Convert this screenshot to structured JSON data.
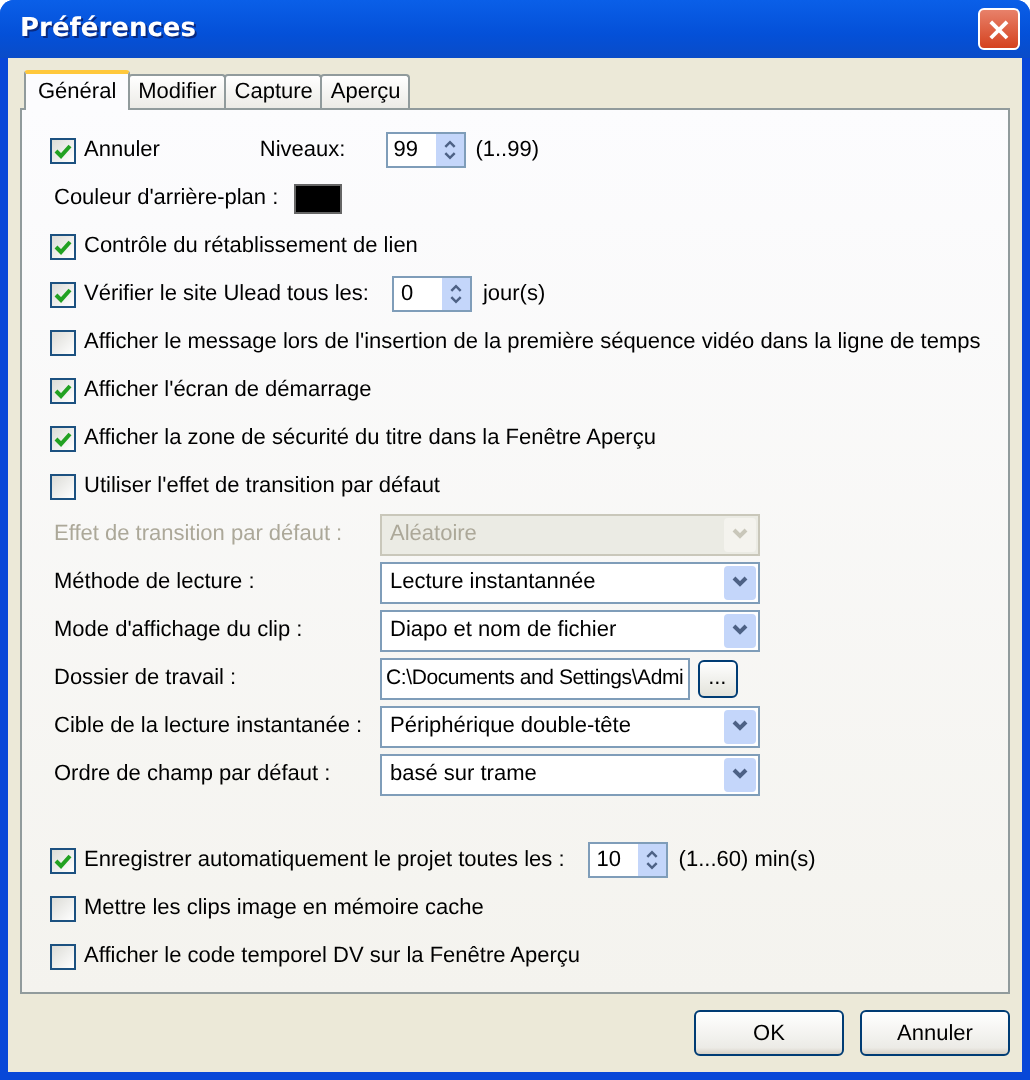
{
  "window": {
    "title": "Préférences",
    "close": "×"
  },
  "tabs": [
    {
      "label": "Général",
      "selected": true
    },
    {
      "label": "Modifier",
      "selected": false
    },
    {
      "label": "Capture",
      "selected": false
    },
    {
      "label": "Aperçu",
      "selected": false
    }
  ],
  "sections": [
    {
      "rows": [
        {
          "kind": "check_spin",
          "label": "Annuler",
          "checked": true,
          "spin_label": "Niveaux:",
          "value": "99",
          "suffix": "(1..99)"
        },
        {
          "kind": "color",
          "label": "Couleur d'arrière-plan :",
          "color": "#000000"
        },
        {
          "kind": "check",
          "label": "Contrôle du rétablissement de lien",
          "checked": true
        },
        {
          "kind": "check_spin",
          "label": "Vérifier le site Ulead tous les:",
          "checked": true,
          "value": "0",
          "suffix": "jour(s)"
        },
        {
          "kind": "check",
          "label": "Afficher le message lors de l'insertion de la première séquence vidéo dans la ligne de temps",
          "checked": false
        },
        {
          "kind": "check",
          "label": "Afficher l'écran de démarrage",
          "checked": true
        },
        {
          "kind": "check",
          "label": "Afficher la zone de sécurité du titre dans la Fenêtre Aperçu",
          "checked": true
        },
        {
          "kind": "check",
          "label": "Utiliser l'effet de transition par défaut",
          "checked": false
        },
        {
          "kind": "select",
          "label": "Effet de transition par défaut :",
          "value": "Aléatoire",
          "disabled": true
        },
        {
          "kind": "select",
          "label": "Méthode de lecture :",
          "value": "Lecture instantannée",
          "disabled": false
        },
        {
          "kind": "select",
          "label": "Mode d'affichage du clip :",
          "value": "Diapo et nom de fichier",
          "disabled": false
        },
        {
          "kind": "path",
          "label": "Dossier de travail :",
          "value": "C:\\Documents and Settings\\Admi",
          "button": "..."
        },
        {
          "kind": "select",
          "label": "Cible de la lecture instantanée :",
          "value": "Périphérique double-tête",
          "disabled": false
        },
        {
          "kind": "select",
          "label": "Ordre de champ par défaut :",
          "value": "basé sur trame",
          "disabled": false
        }
      ]
    },
    {
      "rows": [
        {
          "kind": "check_spin",
          "label": "Enregistrer automatiquement le projet toutes les :",
          "checked": true,
          "value": "10",
          "suffix": "(1...60) min(s)"
        },
        {
          "kind": "check",
          "label": "Mettre les clips image en mémoire cache",
          "checked": false
        },
        {
          "kind": "check",
          "label": "Afficher le code temporel DV sur la Fenêtre Aperçu",
          "checked": false
        }
      ]
    }
  ],
  "buttons": [
    "OK",
    "Annuler"
  ]
}
